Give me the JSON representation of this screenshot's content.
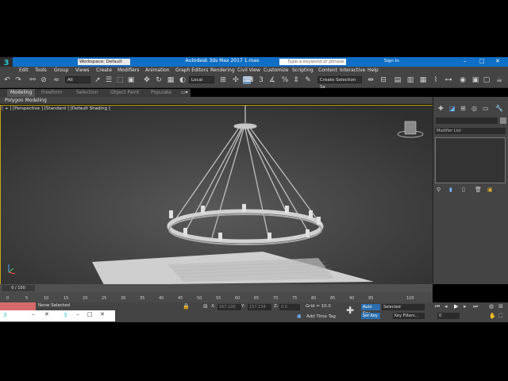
{
  "app": {
    "title": "Autodesk 3ds Max 2017   1.max",
    "logo": "3",
    "workspace": "Workspace: Default",
    "search_placeholder": "Type a keyword or phrase",
    "sign_in": "Sign In"
  },
  "menu": [
    "Edit",
    "Tools",
    "Group",
    "Views",
    "Create",
    "Modifiers",
    "Animation",
    "Graph Editors",
    "Rendering",
    "Civil View",
    "Customize",
    "Scripting",
    "Content",
    "Interactive",
    "Help"
  ],
  "toolbar": {
    "filter": "All",
    "coord": "Local",
    "selection_set": "Create Selection Se"
  },
  "ribbon": {
    "tabs": [
      "Modeling",
      "Freeform",
      "Selection",
      "Object Paint",
      "Populate"
    ],
    "panel_label": "Polygon Modeling"
  },
  "viewport": {
    "label": "[ + ] [Perspective ] [Standard ] [Default Shading ]"
  },
  "command_panel": {
    "modifier_list": "Modifier List"
  },
  "timeline": {
    "frame": "0 / 100",
    "ticks": [
      "0",
      "5",
      "10",
      "15",
      "20",
      "25",
      "30",
      "35",
      "40",
      "45",
      "50",
      "55",
      "60",
      "65",
      "70",
      "75",
      "80",
      "85",
      "90",
      "95",
      "100"
    ]
  },
  "status": {
    "selection": "None Selected",
    "x_label": "X:",
    "x_val": "167.100",
    "y_label": "Y:",
    "y_val": "157.134",
    "z_label": "Z:",
    "z_val": "0.0",
    "grid": "Grid = 10.0",
    "add_time_tag": "Add Time Tag",
    "auto_key": "Auto Key",
    "set_key": "Set Key",
    "selected": "Selected",
    "key_filters": "Key Filters...",
    "frame_field": "0"
  },
  "colors": {
    "titlebar": "#0f6fc6",
    "viewport_border": "#c6a41a",
    "maxscript": "#d66a6a"
  }
}
